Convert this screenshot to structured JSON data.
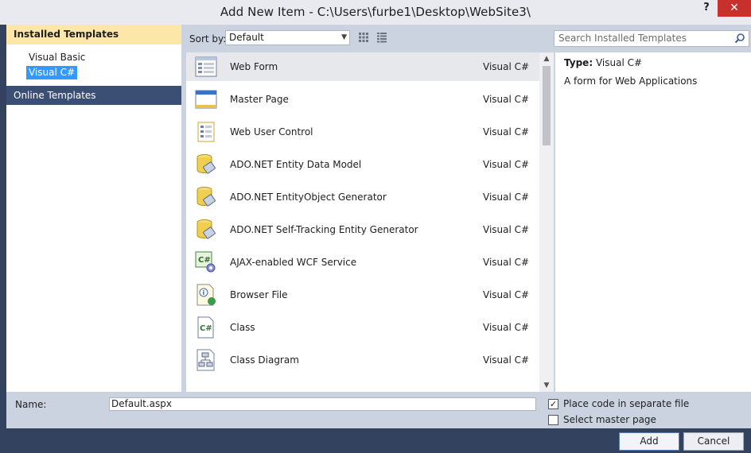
{
  "window": {
    "title": "Add New Item - C:\\Users\\furbe1\\Desktop\\WebSite3\\",
    "help": "?",
    "close": "✕"
  },
  "leftpane": {
    "header": "Installed Templates",
    "items": [
      {
        "label": "Visual Basic",
        "selected": false
      },
      {
        "label": "Visual C#",
        "selected": true
      }
    ],
    "online": "Online Templates"
  },
  "toolbar": {
    "sort_label": "Sort by:",
    "sort_value": "Default",
    "search_placeholder": "Search Installed Templates"
  },
  "templates": [
    {
      "name": "Web Form",
      "lang": "Visual C#",
      "icon": "web-form-icon",
      "selected": true
    },
    {
      "name": "Master Page",
      "lang": "Visual C#",
      "icon": "master-page-icon",
      "selected": false
    },
    {
      "name": "Web User Control",
      "lang": "Visual C#",
      "icon": "user-control-icon",
      "selected": false
    },
    {
      "name": "ADO.NET Entity Data Model",
      "lang": "Visual C#",
      "icon": "database-icon",
      "selected": false
    },
    {
      "name": "ADO.NET EntityObject Generator",
      "lang": "Visual C#",
      "icon": "database-icon",
      "selected": false
    },
    {
      "name": "ADO.NET Self-Tracking Entity Generator",
      "lang": "Visual C#",
      "icon": "database-icon",
      "selected": false
    },
    {
      "name": "AJAX-enabled WCF Service",
      "lang": "Visual C#",
      "icon": "wcf-service-icon",
      "selected": false
    },
    {
      "name": "Browser File",
      "lang": "Visual C#",
      "icon": "browser-file-icon",
      "selected": false
    },
    {
      "name": "Class",
      "lang": "Visual C#",
      "icon": "class-icon",
      "selected": false
    },
    {
      "name": "Class Diagram",
      "lang": "Visual C#",
      "icon": "class-diagram-icon",
      "selected": false
    }
  ],
  "detail": {
    "type_label": "Type:",
    "type_value": "Visual C#",
    "description": "A form for Web Applications"
  },
  "bottom": {
    "name_label": "Name:",
    "name_value": "Default.aspx",
    "place_code_label": "Place code in separate file",
    "place_code_checked": true,
    "master_page_label": "Select master page",
    "master_page_checked": false,
    "add_label": "Add",
    "cancel_label": "Cancel"
  },
  "colors": {
    "accent": "#3399ff",
    "header": "#fde7a8",
    "online": "#3b4f74",
    "chrome": "#33425f",
    "close": "#c7302c"
  }
}
